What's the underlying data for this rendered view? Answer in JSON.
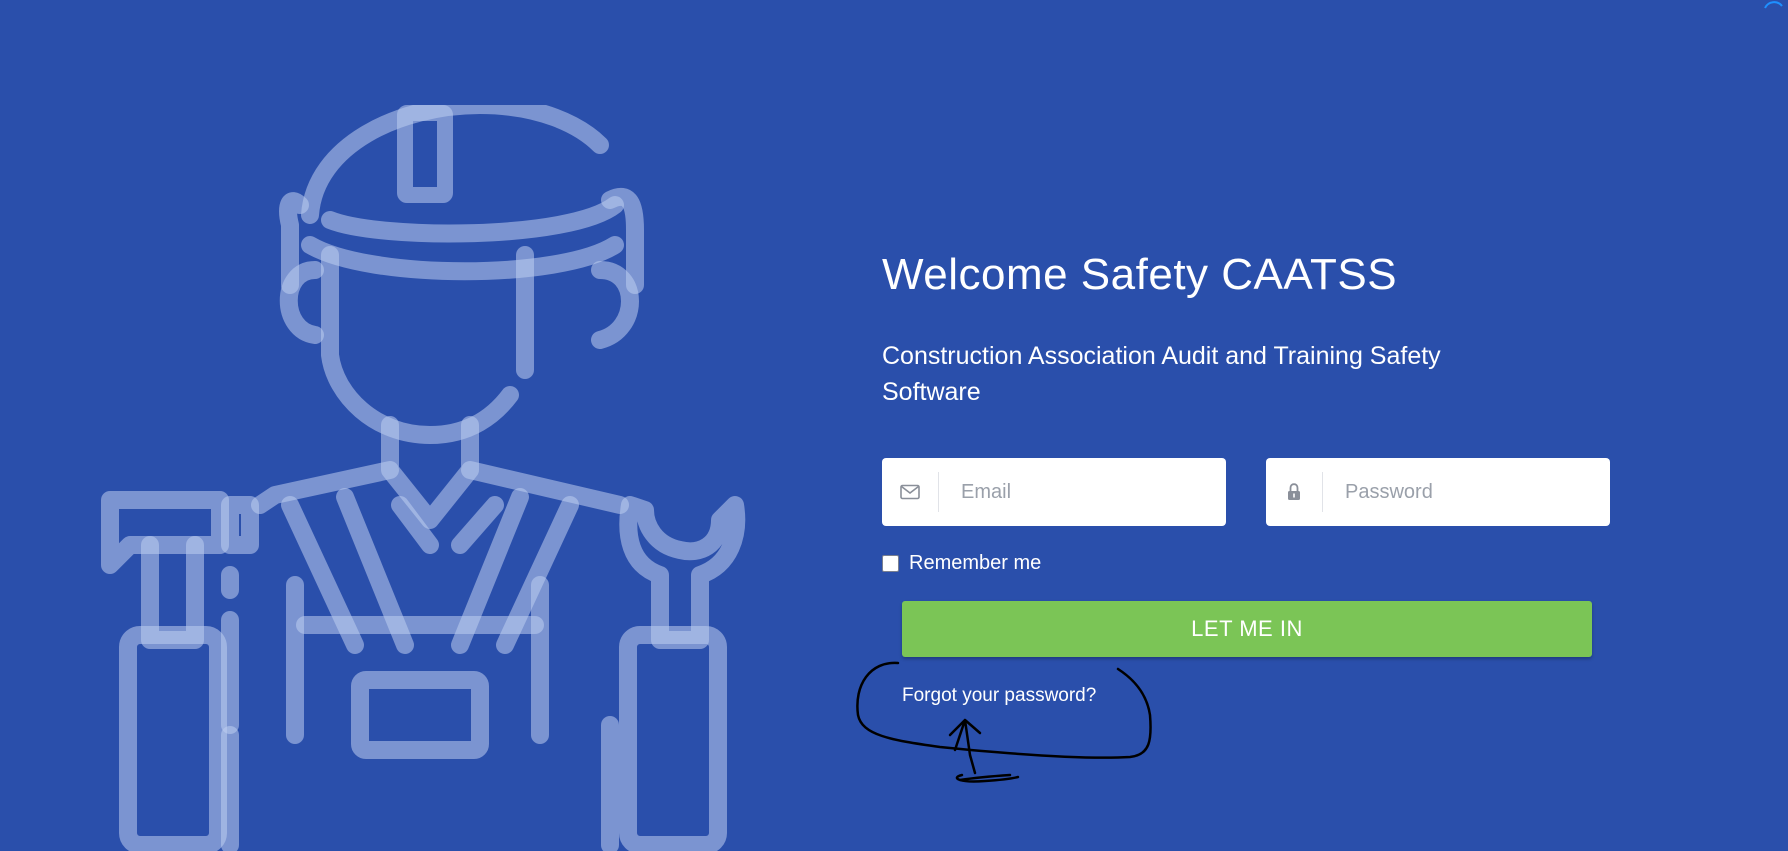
{
  "page": {
    "background_color": "#2a4fab",
    "accent_color": "#7bc556"
  },
  "hero": {
    "title": "Welcome Safety CAATSS",
    "subtitle": "Construction Association Audit and Training Safety Software"
  },
  "login_form": {
    "email": {
      "icon": "envelope-icon",
      "placeholder": "Email",
      "value": ""
    },
    "password": {
      "icon": "lock-icon",
      "placeholder": "Password",
      "value": ""
    },
    "remember_label": "Remember me",
    "remember_checked": false,
    "submit_label": "LET ME IN",
    "forgot_link": "Forgot your password?"
  },
  "illustration": {
    "icon": "construction-worker-icon"
  }
}
